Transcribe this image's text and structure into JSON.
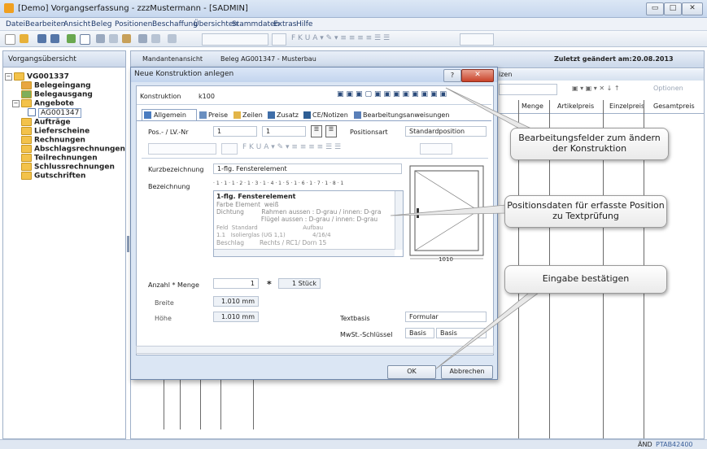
{
  "window": {
    "title": "[Demo] Vorgangserfassung - zzzMustermann - [SADMIN]"
  },
  "menu": [
    "Datei",
    "Bearbeiten",
    "Ansicht",
    "Beleg",
    "Positionen",
    "Beschaffung",
    "Übersichten",
    "Stammdaten",
    "Extras",
    "Hilfe"
  ],
  "left_pane": {
    "title": "Vorgangsübersicht",
    "tree": [
      {
        "label": "VG001337"
      },
      {
        "label": "Belegeingang"
      },
      {
        "label": "Belegausgang"
      },
      {
        "label": "Angebote"
      },
      {
        "label": "AG001347"
      },
      {
        "label": "Aufträge"
      },
      {
        "label": "Lieferscheine"
      },
      {
        "label": "Rechnungen"
      },
      {
        "label": "Abschlagsrechnungen"
      },
      {
        "label": "Teilrechnungen"
      },
      {
        "label": "Schlussrechnungen"
      },
      {
        "label": "Gutschriften"
      }
    ]
  },
  "right_pane": {
    "tab1": "Mandantenansicht",
    "tab2": "Beleg AG001347 - Musterbau",
    "modified_label": "Zuletzt geändert am:",
    "modified_date": "20.08.2013",
    "partial_label": "izen",
    "options": "Optionen",
    "columns": [
      "Menge",
      "Artikelpreis",
      "Einzelpreis",
      "Gesamtpreis"
    ]
  },
  "dialog": {
    "title": "Neue Konstruktion anlegen",
    "konstruktion_label": "Konstruktion",
    "konstruktion_value": "k100",
    "tabs": [
      "Allgemein",
      "Preise",
      "Zeilen",
      "Zusatz",
      "CE/Notizen",
      "Bearbeitungsanweisungen"
    ],
    "pos_label": "Pos.- / LV.-Nr",
    "pos_value1": "1",
    "pos_value2": "1",
    "positionsart_label": "Positionsart",
    "positionsart_value": "Standardposition",
    "kurzbezeichnung_label": "Kurzbezeichnung",
    "kurzbezeichnung_value": "1-flg. Fensterelement",
    "bezeichnung_label": "Bezeichnung",
    "ruler": "· 1 · 1 · 1 · 2 · 1 · 3 · 1 · 4 · 1 · 5 · 1 · 6 · 1 · 7 · 1 · 8 · 1",
    "text_lines": [
      "1-flg. Fensterelement",
      "Farbe Element  weiß",
      "Dichtung         Rahmen aussen : D-grau / innen: D-gra",
      "                       Flügel aussen : D-grau / innen: D-grau",
      "Feld  Standard                         Aufbau",
      "1.1   Isolierglas (UG 1,1)               4/16/4",
      "Beschlag        Rechts / RC1/ Dorn 15"
    ],
    "anzahl_label": "Anzahl * Menge",
    "anzahl_value": "1",
    "multiply": "*",
    "stueck": "1 Stück",
    "breite_label": "Breite",
    "breite_value": "1.010 mm",
    "hoehe_label": "Höhe",
    "hoehe_value": "1.010 mm",
    "textbasis_label": "Textbasis",
    "textbasis_value": "Formular",
    "mwst_label": "MwSt.-Schlüssel",
    "mwst_value1": "Basis",
    "mwst_value2": "Basis",
    "dim_label": "1010",
    "ok": "OK",
    "cancel": "Abbrechen"
  },
  "callouts": [
    "Bearbeitungsfelder zum ändern der Konstruktion",
    "Positionsdaten für erfasste Position zu Textprüfung",
    "Eingabe bestätigen"
  ],
  "status": {
    "left": "ÄND",
    "right": "PTAB42400"
  }
}
